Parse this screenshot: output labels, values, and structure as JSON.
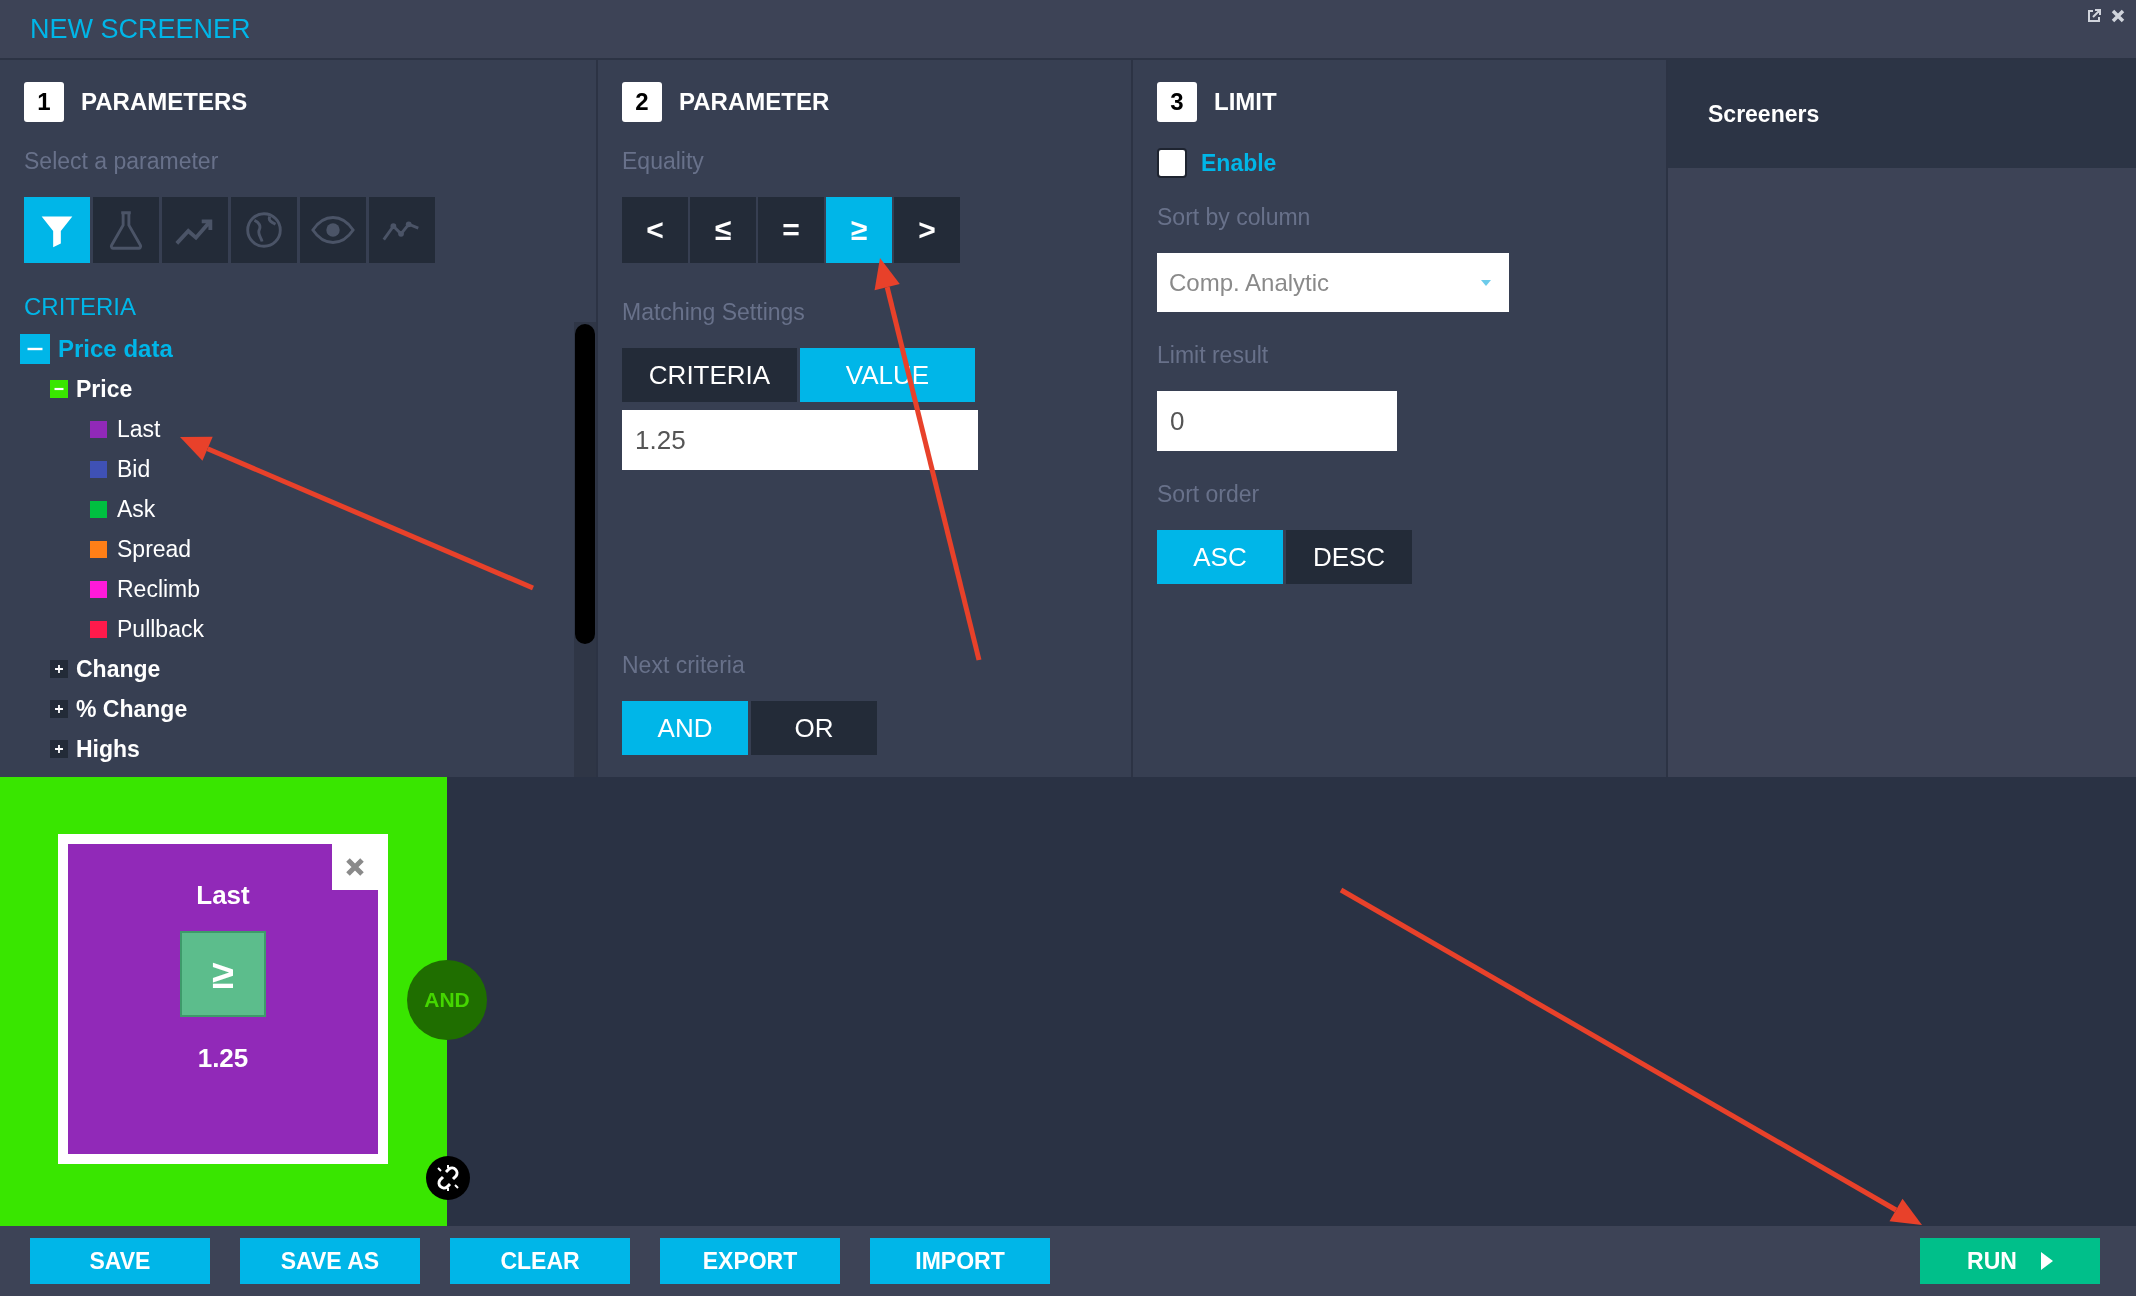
{
  "window": {
    "title": "NEW SCREENER"
  },
  "parameters_panel": {
    "number": "1",
    "title": "PARAMETERS",
    "hint": "Select a parameter",
    "categories": [
      {
        "kind": "filter",
        "selected": true
      },
      {
        "kind": "flask",
        "selected": false
      },
      {
        "kind": "trend",
        "selected": false
      },
      {
        "kind": "globe",
        "selected": false
      },
      {
        "kind": "eye",
        "selected": false
      },
      {
        "kind": "line",
        "selected": false
      }
    ],
    "section": "CRITERIA",
    "tree": [
      {
        "label": "Price data",
        "expanded": true,
        "children": [
          {
            "label": "Price",
            "expanded": true,
            "children": [
              {
                "label": "Last",
                "color": "#9129b8"
              },
              {
                "label": "Bid",
                "color": "#3f51b5"
              },
              {
                "label": "Ask",
                "color": "#00c040"
              },
              {
                "label": "Spread",
                "color": "#ff7f17"
              },
              {
                "label": "Reclimb",
                "color": "#ff1ad9"
              },
              {
                "label": "Pullback",
                "color": "#ff1a4b"
              }
            ]
          },
          {
            "label": "Change",
            "expanded": false
          },
          {
            "label": "% Change",
            "expanded": false
          },
          {
            "label": "Highs",
            "expanded": false
          }
        ]
      }
    ]
  },
  "parameter_panel": {
    "number": "2",
    "title": "PARAMETER",
    "equality_label": "Equality",
    "operators": [
      {
        "label": "<",
        "selected": false
      },
      {
        "label": "≤",
        "selected": false
      },
      {
        "label": "=",
        "selected": false
      },
      {
        "label": "≥",
        "selected": true
      },
      {
        "label": ">",
        "selected": false
      }
    ],
    "matching_label": "Matching Settings",
    "match_modes": [
      {
        "label": "CRITERIA",
        "selected": false
      },
      {
        "label": "VALUE",
        "selected": true
      }
    ],
    "value": "1.25",
    "next_label": "Next criteria",
    "next_options": [
      {
        "label": "AND",
        "selected": true
      },
      {
        "label": "OR",
        "selected": false
      }
    ]
  },
  "limit_panel": {
    "number": "3",
    "title": "LIMIT",
    "enable": {
      "label": "Enable",
      "checked": false
    },
    "sort_column_label": "Sort by column",
    "sort_column": "Comp. Analytic",
    "limit_label": "Limit result",
    "limit": "0",
    "sort_order_label": "Sort order",
    "sort_orders": [
      {
        "label": "ASC",
        "selected": true
      },
      {
        "label": "DESC",
        "selected": false
      }
    ]
  },
  "screeners_panel": {
    "title": "Screeners"
  },
  "canvas": {
    "blocks": [
      {
        "name": "Last",
        "operator": "≥",
        "value": "1.25",
        "color": "#9129b8",
        "connector": "AND"
      }
    ]
  },
  "footer": {
    "buttons": [
      "SAVE",
      "SAVE AS",
      "CLEAR",
      "EXPORT",
      "IMPORT"
    ],
    "run": "RUN"
  }
}
